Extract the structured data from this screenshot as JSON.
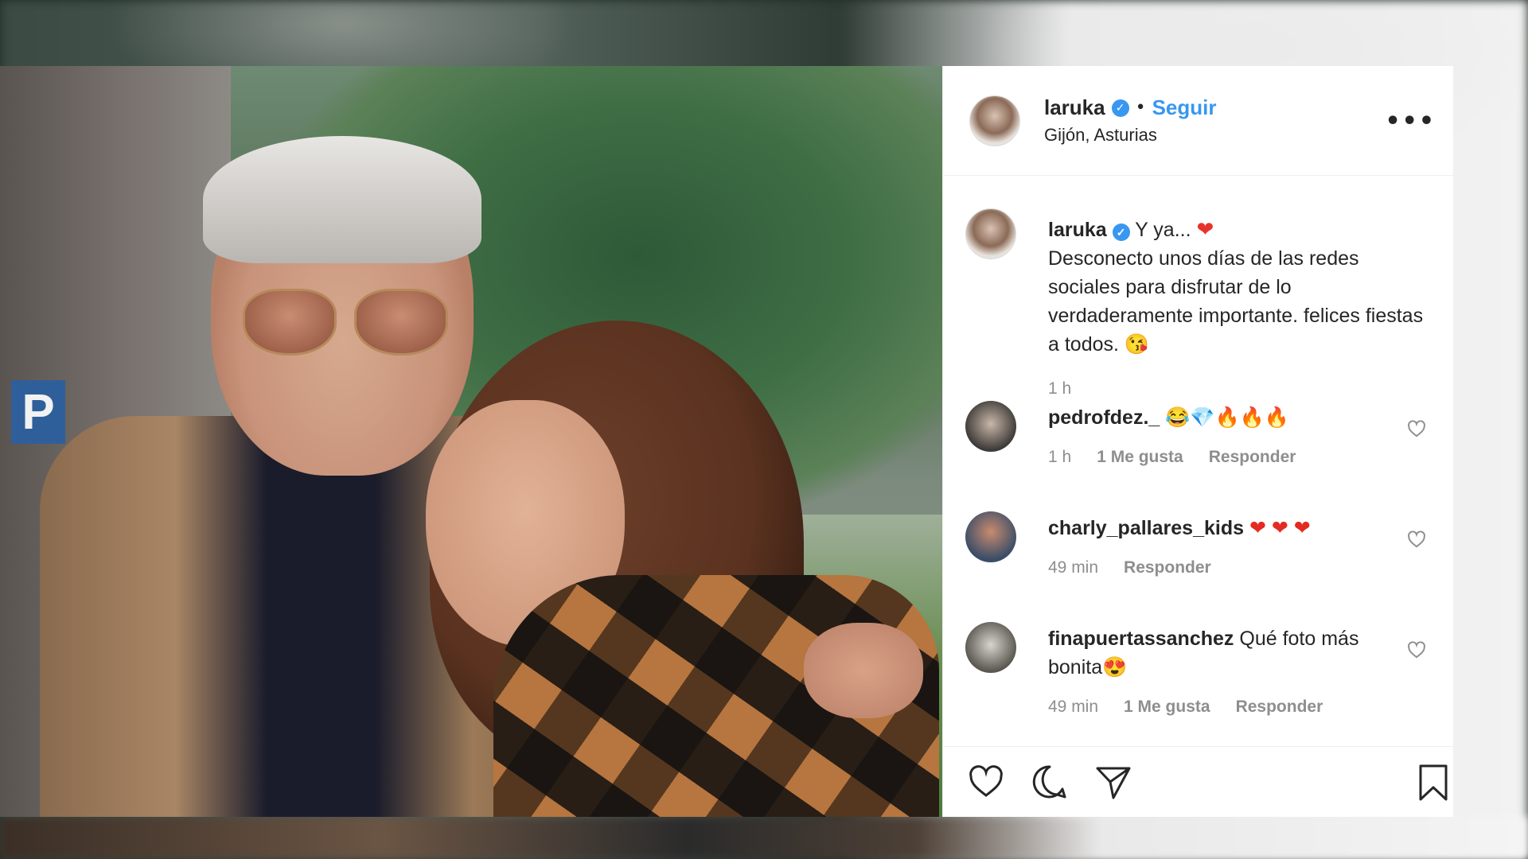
{
  "post": {
    "author": {
      "username": "laruka",
      "verified_glyph": "✓",
      "separator": "•",
      "follow_label": "Seguir",
      "location": "Gijón, Asturias",
      "more_label": "•••"
    },
    "photo": {
      "sign_text": "P"
    },
    "caption": {
      "username": "laruka",
      "text_start": "Y ya...",
      "heart": "❤",
      "text_body": "Desconecto unos días de las redes sociales para disfrutar de lo verdaderamente importante. felices fiestas a todos.",
      "emoji_end": "😘",
      "time": "1 h"
    },
    "comments": [
      {
        "username": "pedrofdez._",
        "emojis": [
          "😂",
          "💎",
          "🔥",
          "🔥",
          "🔥"
        ],
        "text": "",
        "time": "1 h",
        "likes": "1 Me gusta",
        "reply": "Responder"
      },
      {
        "username": "charly_pallares_kids",
        "emojis": [
          "❤",
          "❤",
          "❤"
        ],
        "text": "",
        "time": "49 min",
        "likes": "",
        "reply": "Responder"
      },
      {
        "username": "finapuertassanchez",
        "text": "Qué foto más bonita",
        "emojis": [
          "😍"
        ],
        "time": "49 min",
        "likes": "1 Me gusta",
        "reply": "Responder"
      }
    ],
    "actions": {
      "like_icon": "heart-outline-icon",
      "comment_icon": "speech-bubble-icon",
      "share_icon": "paper-plane-icon",
      "save_icon": "bookmark-icon"
    },
    "colors": {
      "link_blue": "#3897f0",
      "text": "#262626",
      "muted": "#8e8e8e",
      "border": "#efefef"
    }
  }
}
